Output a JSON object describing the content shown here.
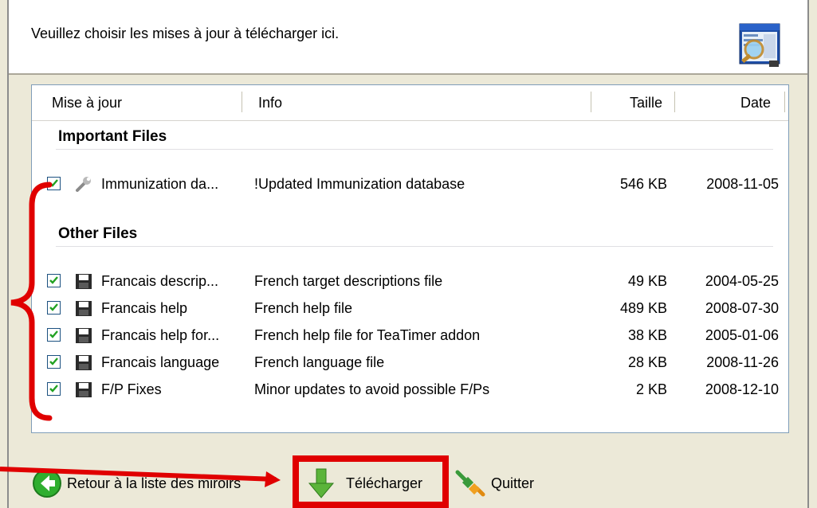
{
  "header": {
    "prompt": "Veuillez choisir les mises à jour à télécharger ici."
  },
  "columns": {
    "update": "Mise à jour",
    "info": "Info",
    "size": "Taille",
    "date": "Date"
  },
  "groups": [
    {
      "title": "Important Files",
      "items": [
        {
          "checked": true,
          "icon": "wrench-icon",
          "name": "Immunization da...",
          "info": "!Updated Immunization database",
          "size": "546 KB",
          "date": "2008-11-05"
        }
      ]
    },
    {
      "title": "Other Files",
      "items": [
        {
          "checked": true,
          "icon": "floppy-disk-icon",
          "name": "Francais descrip...",
          "info": "French target descriptions file",
          "size": "49 KB",
          "date": "2004-05-25"
        },
        {
          "checked": true,
          "icon": "floppy-disk-icon",
          "name": "Francais help",
          "info": "French help file",
          "size": "489 KB",
          "date": "2008-07-30"
        },
        {
          "checked": true,
          "icon": "floppy-disk-icon",
          "name": "Francais help for...",
          "info": "French help file for TeaTimer addon",
          "size": "38 KB",
          "date": "2005-01-06"
        },
        {
          "checked": true,
          "icon": "floppy-disk-icon",
          "name": "Francais language",
          "info": "French language file",
          "size": "28 KB",
          "date": "2008-11-26"
        },
        {
          "checked": true,
          "icon": "floppy-disk-icon",
          "name": "F/P Fixes",
          "info": "Minor updates to avoid possible F/Ps",
          "size": "2 KB",
          "date": "2008-12-10"
        }
      ]
    }
  ],
  "toolbar": {
    "back_label": "Retour à la liste des miroirs",
    "download_label": "Télécharger",
    "quit_label": "Quitter"
  },
  "colors": {
    "highlight": "#e00000",
    "window_bg": "#ece9d8",
    "list_border": "#7f9db9"
  }
}
